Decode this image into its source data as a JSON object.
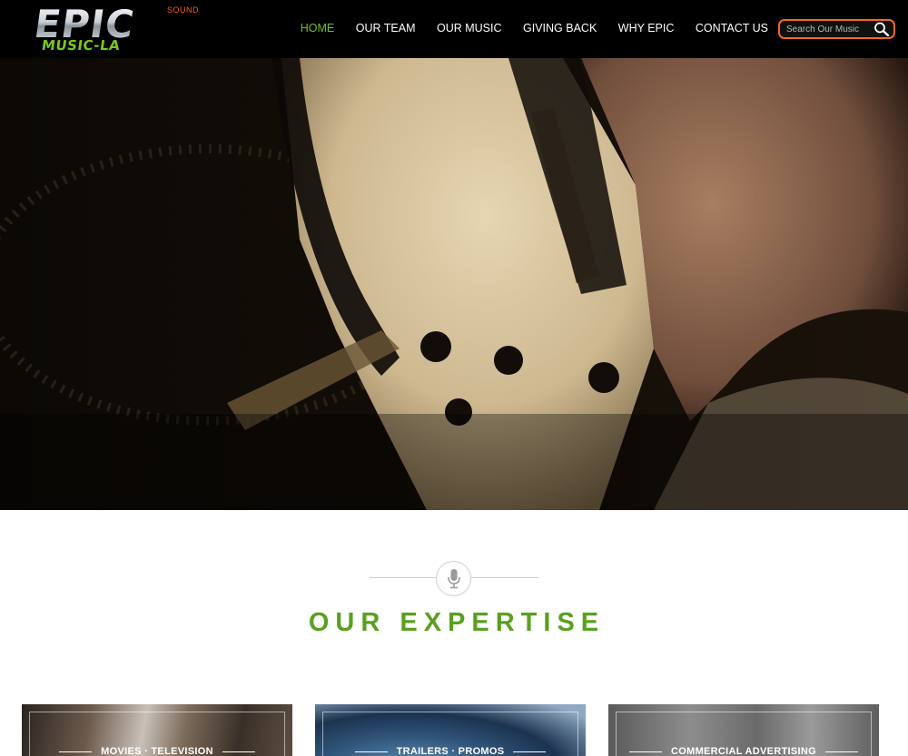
{
  "brand": {
    "logo_line1": "EPIC",
    "logo_line2": "MUSIC-LA",
    "tagline": "SOUND",
    "accent_green": "#6fbf2a",
    "accent_orange": "#f26a21"
  },
  "nav": {
    "items": [
      {
        "label": "HOME",
        "active": true
      },
      {
        "label": "OUR TEAM",
        "active": false
      },
      {
        "label": "OUR MUSIC",
        "active": false
      },
      {
        "label": "GIVING BACK",
        "active": false
      },
      {
        "label": "WHY EPIC",
        "active": false
      },
      {
        "label": "CONTACT US",
        "active": false
      }
    ]
  },
  "search": {
    "placeholder": "Search Our Music",
    "icon": "search-icon"
  },
  "hero": {
    "image": "guitar-closeup"
  },
  "expertise": {
    "icon": "microphone-icon",
    "heading": "OUR EXPERTISE",
    "cards": [
      {
        "title": "MOVIES · TELEVISION"
      },
      {
        "title": "TRAILERS · PROMOS"
      },
      {
        "title": "COMMERCIAL ADVERTISING"
      }
    ]
  }
}
